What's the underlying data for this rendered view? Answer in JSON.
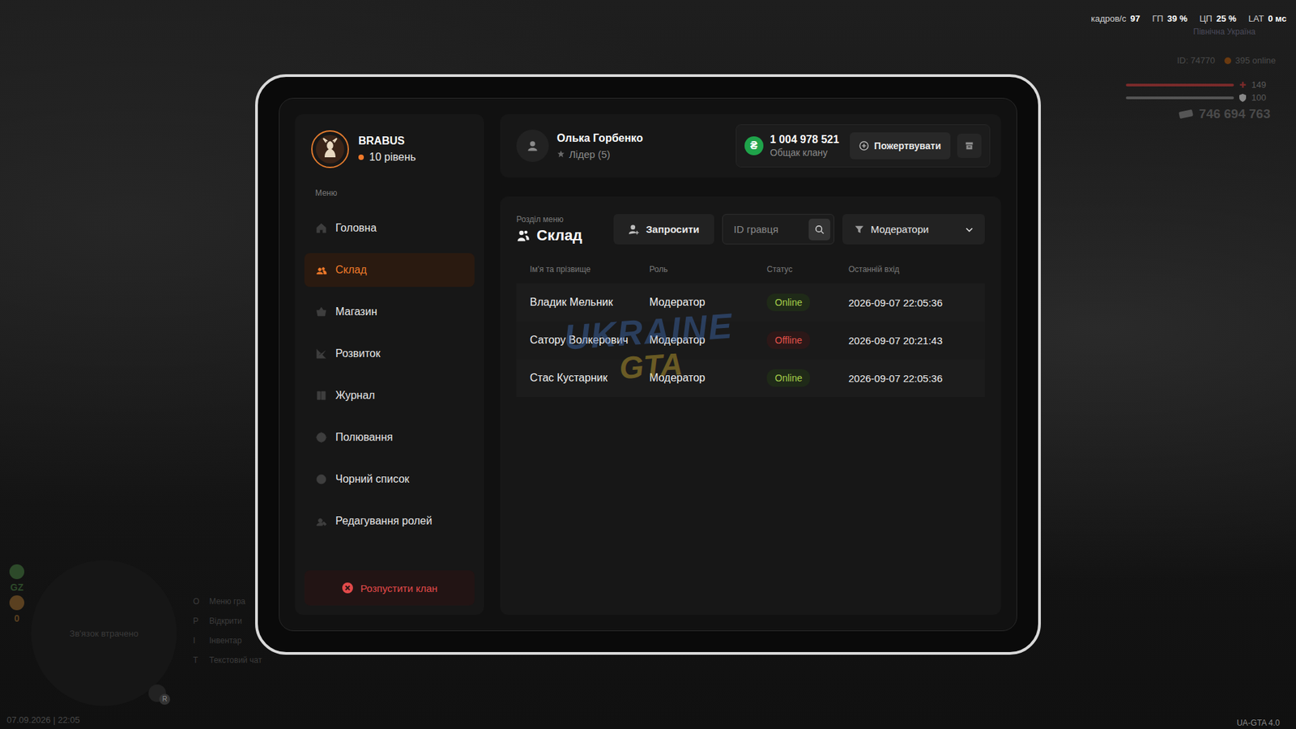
{
  "hud": {
    "stats": [
      {
        "label": "кадров/с",
        "value": "97"
      },
      {
        "label": "ГП",
        "value": "39 %"
      },
      {
        "label": "ЦП",
        "value": "25 %"
      },
      {
        "label": "LAT",
        "value": "0 мс"
      }
    ],
    "region": "Північна Україна",
    "player_id": "ID: 74770",
    "online": "395 online",
    "health": {
      "value": "149",
      "level": 1
    },
    "armor": {
      "value": "100",
      "level": 1
    },
    "money": "746 694 763",
    "minimap_text": "Зв'язок втрачено",
    "side_marks": [
      "GZ",
      "0"
    ],
    "hints": [
      {
        "key": "O",
        "label": "Меню гра"
      },
      {
        "key": "P",
        "label": "Відкрити"
      },
      {
        "key": "I",
        "label": "Інвентар"
      },
      {
        "key": "T",
        "label": "Текстовий чат"
      }
    ],
    "mic_key": "R",
    "datetime": "07.09.2026 | 22:05",
    "version": "UA-GTA 4.0"
  },
  "watermark": [
    "UKRAINE",
    "GTA"
  ],
  "clan": {
    "name": "BRABUS",
    "level": "10 рівень"
  },
  "menu_label": "Меню",
  "menu": [
    {
      "label": "Головна",
      "selected": false
    },
    {
      "label": "Склад",
      "selected": true
    },
    {
      "label": "Магазин",
      "selected": false
    },
    {
      "label": "Розвиток",
      "selected": false
    },
    {
      "label": "Журнал",
      "selected": false
    },
    {
      "label": "Полювання",
      "selected": false
    },
    {
      "label": "Чорний список",
      "selected": false
    },
    {
      "label": "Редагування ролей",
      "selected": false
    }
  ],
  "disband_button": "Розпустити клан",
  "leader": {
    "name": "Олька Горбенко",
    "role": "Лідер (5)"
  },
  "treasury": {
    "currency_icon": "₴",
    "amount": "1 004 978 521",
    "label": "Общак клану"
  },
  "donate_button": "Пожертвувати",
  "section": {
    "caption": "Розділ меню",
    "title": "Склад"
  },
  "invite_button": "Запросити",
  "search": {
    "placeholder": "ID гравця"
  },
  "filter": {
    "value": "Модератори"
  },
  "table": {
    "columns": [
      "Ім'я та прізвище",
      "Роль",
      "Статус",
      "Останній вхід"
    ],
    "rows": [
      {
        "name": "Владик Мельник",
        "role": "Модератор",
        "status": "Online",
        "online": true,
        "color": "#a6d04a",
        "last_login": "2026-09-07 22:05:36"
      },
      {
        "name": "Сатору Волкерович",
        "role": "Модератор",
        "status": "Offline",
        "online": false,
        "color": "#e5534b",
        "last_login": "2026-09-07 20:21:43"
      },
      {
        "name": "Стас Кустарник",
        "role": "Модератор",
        "status": "Online",
        "online": true,
        "color": "#a6d04a",
        "last_login": "2026-09-07 22:05:36"
      }
    ]
  }
}
